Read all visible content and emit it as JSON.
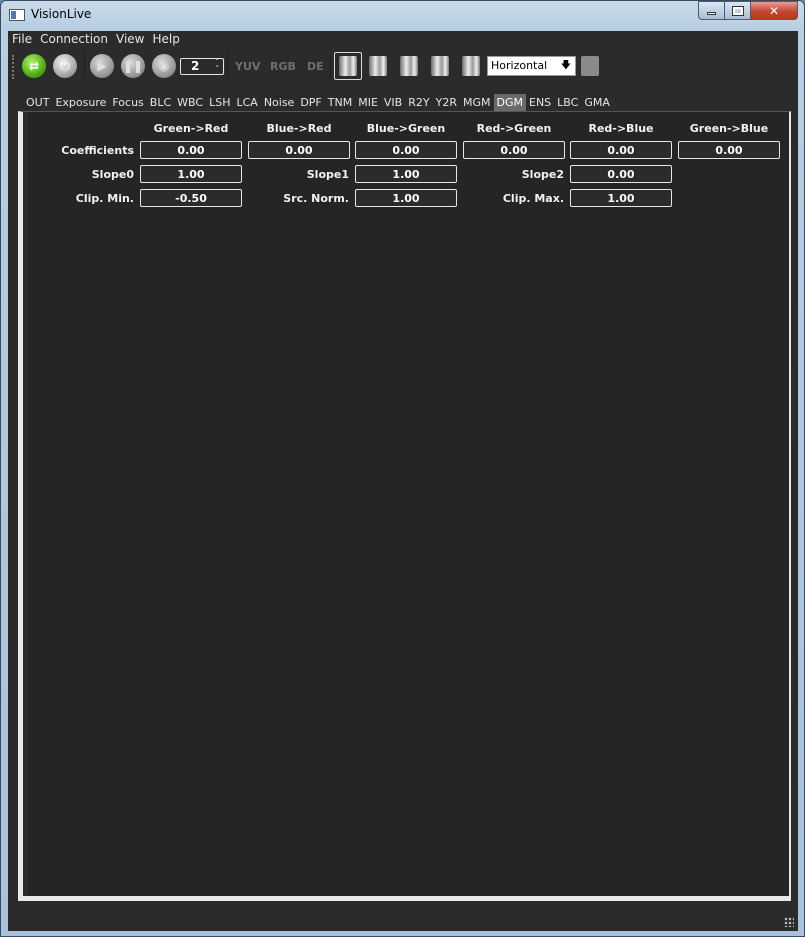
{
  "window": {
    "title": "VisionLive"
  },
  "menu": [
    "File",
    "Connection",
    "View",
    "Help"
  ],
  "toolbar": {
    "frame_count": "2",
    "format_buttons": [
      "YUV",
      "RGB",
      "DE"
    ],
    "layout_select": "Horizontal",
    "icons": [
      "connect-icon",
      "plug-icon",
      "play-icon",
      "pause-icon",
      "capture-icon",
      "image-view-icon",
      "camera-icon",
      "image-icon-1",
      "image-icon-2",
      "image-icon-3",
      "close-view-icon"
    ]
  },
  "tabs": {
    "items": [
      "OUT",
      "Exposure",
      "Focus",
      "BLC",
      "WBC",
      "LSH",
      "LCA",
      "Noise",
      "DPF",
      "TNM",
      "MIE",
      "VIB",
      "R2Y",
      "Y2R",
      "MGM",
      "DGM",
      "ENS",
      "LBC",
      "GMA"
    ],
    "active": "DGM"
  },
  "dgm": {
    "columns": [
      "Green->Red",
      "Blue->Red",
      "Blue->Green",
      "Red->Green",
      "Red->Blue",
      "Green->Blue"
    ],
    "coefficients_label": "Coefficients",
    "coefficients": [
      "0.00",
      "0.00",
      "0.00",
      "0.00",
      "0.00",
      "0.00"
    ],
    "slope0_label": "Slope0",
    "slope0": "1.00",
    "slope1_label": "Slope1",
    "slope1": "1.00",
    "slope2_label": "Slope2",
    "slope2": "0.00",
    "clip_min_label": "Clip. Min.",
    "clip_min": "-0.50",
    "src_norm_label": "Src. Norm.",
    "src_norm": "1.00",
    "clip_max_label": "Clip. Max.",
    "clip_max": "1.00"
  },
  "colors": {
    "background": "#252525",
    "accent_green": "#4db016",
    "tab_active": "#6a6a6a"
  }
}
